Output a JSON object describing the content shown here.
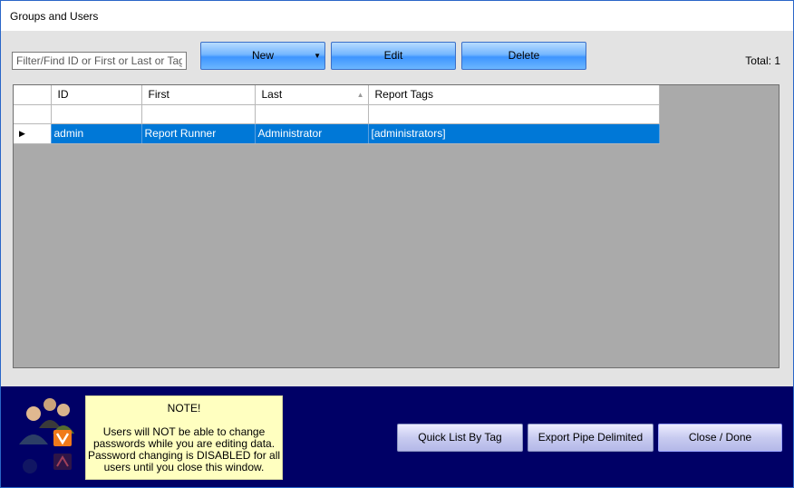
{
  "window": {
    "title": "Groups and Users"
  },
  "toolbar": {
    "filter_placeholder": "Filter/Find ID or First or Last or Tags",
    "filter_value": "",
    "new_label": "New",
    "edit_label": "Edit",
    "delete_label": "Delete",
    "total_label": "Total: 1"
  },
  "grid": {
    "columns": [
      "ID",
      "First",
      "Last",
      "Report Tags"
    ],
    "sorted_column": "Last",
    "rows": [
      {
        "id": "admin",
        "first": "Report Runner",
        "last": "Administrator",
        "tags": "[administrators]"
      }
    ]
  },
  "note": {
    "heading": "NOTE!",
    "body": "Users will NOT be able to change passwords while you are editing data. Password changing is DISABLED for all users until you close this window."
  },
  "footer": {
    "quick_list_label": "Quick List By Tag",
    "export_label": "Export Pipe Delimited",
    "close_label": "Close / Done"
  },
  "colors": {
    "selection": "#0078d7",
    "footer_bg": "#000066",
    "grid_bg": "#aaaaaa",
    "note_bg": "#ffffc0",
    "logo_badge": "#f07a1a"
  }
}
